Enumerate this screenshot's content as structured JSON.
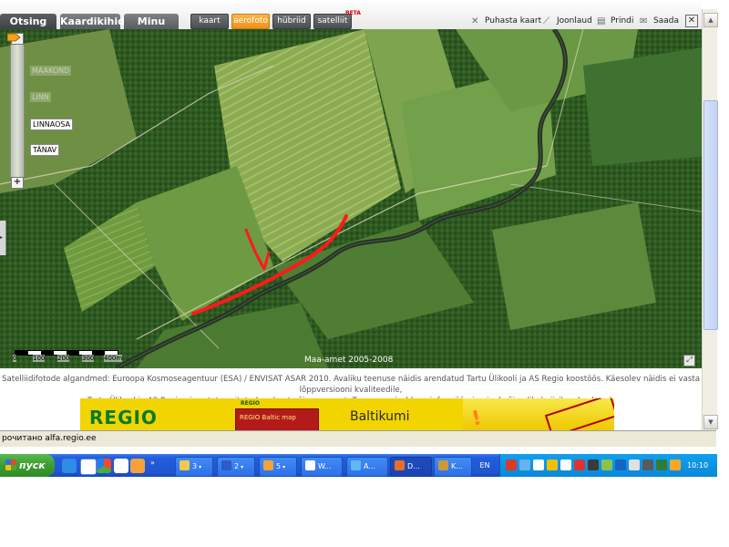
{
  "toolbar": {
    "tabs": [
      {
        "label": "Otsing",
        "active": true
      },
      {
        "label": "Kaardikihid",
        "active": false
      },
      {
        "label": "Minu kaart",
        "active": false
      }
    ],
    "map_types": [
      {
        "label": "kaart",
        "selected": false
      },
      {
        "label": "aerofoto",
        "selected": true
      },
      {
        "label": "hübriid",
        "selected": false
      },
      {
        "label": "satelliit",
        "selected": false
      }
    ],
    "beta_label": "BETA",
    "tools": [
      {
        "label": "Puhasta kaart",
        "icon": "clear-map-icon"
      },
      {
        "label": "Joonlaud",
        "icon": "ruler-icon"
      },
      {
        "label": "Prindi",
        "icon": "print-icon"
      },
      {
        "label": "Saada",
        "icon": "envelope-icon"
      }
    ],
    "close_glyph": "✕"
  },
  "map": {
    "zoom_in": "−",
    "zoom_out": "+",
    "zoom_levels": [
      "MAAKOND",
      "LINN",
      "LINNAOSA",
      "TÄNAV"
    ],
    "active_zoom_level": "TÄNAV",
    "scale_ticks": [
      "0",
      "100",
      "200",
      "300",
      "400m"
    ],
    "copyright": "Maa-amet 2005-2008",
    "fullscreen_glyph": "⤢",
    "annotation_color": "#ff1a1a"
  },
  "disclaimer": {
    "line1": "Satelliidifotode algandmed: Euroopa Kosmoseagentuur (ESA) / ENVISAT ASAR 2010. Avaliku teenuse näidis arendatud Tartu Ülikooli ja AS Regio koostöös. Käesolev näidis ei vasta lõppversiooni kvaliteedile,",
    "line2": "Tartu Ülikool ja AS Regio ei vastuta esitatud andmete õigsuse eest. Teenuses sisalduva info müümine igal võimalikul viisil on keelatud."
  },
  "banner": {
    "brand": "REGIO",
    "book_brand": "REGIO",
    "book_title": "REGIO Baltic map",
    "headline": "Baltikumi"
  },
  "statusbar": {
    "text": "рочитано alfa.regio.ee"
  },
  "taskbar": {
    "start_label": "пуск",
    "tasks": [
      {
        "label": "3",
        "icon_color": "#f2c94c",
        "active": false,
        "grouped": true
      },
      {
        "label": "2",
        "icon_color": "#2b5cc8",
        "active": false,
        "grouped": true
      },
      {
        "label": "5",
        "icon_color": "#f7a13a",
        "active": false,
        "grouped": true
      },
      {
        "label": "W...",
        "icon_color": "#ffffff",
        "active": false,
        "grouped": false
      },
      {
        "label": "A...",
        "icon_color": "#60b8f0",
        "active": false,
        "grouped": false
      },
      {
        "label": "D...",
        "icon_color": "#e76f2a",
        "active": true,
        "grouped": false
      },
      {
        "label": "K...",
        "icon_color": "#c99a3a",
        "active": false,
        "grouped": false
      }
    ],
    "language": "EN",
    "clock": "10:10"
  }
}
